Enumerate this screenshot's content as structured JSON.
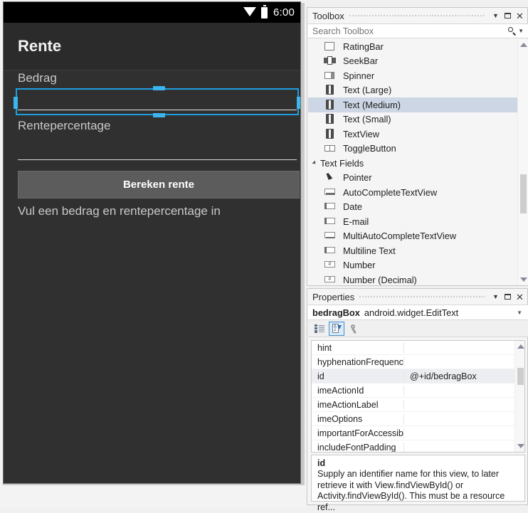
{
  "designer": {
    "status_bar": {
      "time": "6:00",
      "wifi_icon": "wifi-icon",
      "battery_icon": "battery-icon"
    },
    "app_title": "Rente",
    "labels": {
      "bedrag": "Bedrag",
      "rentepercentage": "Rentepercentage"
    },
    "bedrag_field_value": "",
    "rente_field_value": "",
    "button_label": "Bereken rente",
    "result_text": "Vul een bedrag en rentepercentage in",
    "selection_color": "#1e9fe0",
    "handle_color": "#3cb4ee"
  },
  "toolbox": {
    "title": "Toolbox",
    "window_buttons": {
      "dropdown": "chevron-down-icon",
      "maximize": "maximize-icon",
      "close": "close-icon"
    },
    "search": {
      "placeholder": "Search Toolbox",
      "value": "",
      "icon": "search-icon"
    },
    "items": [
      {
        "label": "RatingBar",
        "icon": "square-icon",
        "type": "item",
        "selected": false
      },
      {
        "label": "SeekBar",
        "icon": "seekbar-icon",
        "type": "item",
        "selected": false
      },
      {
        "label": "Spinner",
        "icon": "spinner-icon",
        "type": "item",
        "selected": false
      },
      {
        "label": "Text (Large)",
        "icon": "text-icon",
        "type": "item",
        "selected": false
      },
      {
        "label": "Text (Medium)",
        "icon": "text-icon",
        "type": "item",
        "selected": true
      },
      {
        "label": "Text (Small)",
        "icon": "text-icon",
        "type": "item",
        "selected": false
      },
      {
        "label": "TextView",
        "icon": "text-icon",
        "type": "item",
        "selected": false
      },
      {
        "label": "ToggleButton",
        "icon": "toggle-icon",
        "type": "item",
        "selected": false
      },
      {
        "label": "Text Fields",
        "icon": "expander-icon",
        "type": "group",
        "selected": false
      },
      {
        "label": "Pointer",
        "icon": "pointer-icon",
        "type": "item",
        "selected": false
      },
      {
        "label": "AutoCompleteTextView",
        "icon": "actv-icon",
        "type": "item",
        "selected": false
      },
      {
        "label": "Date",
        "icon": "textfield-icon",
        "type": "item",
        "selected": false
      },
      {
        "label": "E-mail",
        "icon": "textfield-icon",
        "type": "item",
        "selected": false
      },
      {
        "label": "MultiAutoCompleteTextView",
        "icon": "actv-icon",
        "type": "item",
        "selected": false
      },
      {
        "label": "Multiline Text",
        "icon": "textfield-icon",
        "type": "item",
        "selected": false
      },
      {
        "label": "Number",
        "icon": "number-icon",
        "type": "item",
        "selected": false
      },
      {
        "label": "Number (Decimal)",
        "icon": "number-icon",
        "type": "item",
        "selected": false
      }
    ]
  },
  "properties": {
    "title": "Properties",
    "window_buttons": {
      "dropdown": "chevron-down-icon",
      "maximize": "maximize-icon",
      "close": "close-icon"
    },
    "object": {
      "name": "bedragBox",
      "type": "android.widget.EditText"
    },
    "toolbar": {
      "categorized_label": "categorized-view-icon",
      "alphabetical_label": "alphabetical-sort-icon",
      "events_label": "wrench-icon"
    },
    "rows": [
      {
        "name": "hint",
        "value": "",
        "selected": false
      },
      {
        "name": "hyphenationFrequency",
        "value": "",
        "selected": false
      },
      {
        "name": "id",
        "value": "@+id/bedragBox",
        "selected": true
      },
      {
        "name": "imeActionId",
        "value": "",
        "selected": false
      },
      {
        "name": "imeActionLabel",
        "value": "",
        "selected": false
      },
      {
        "name": "imeOptions",
        "value": "",
        "selected": false
      },
      {
        "name": "importantForAccessibi",
        "value": "",
        "selected": false
      },
      {
        "name": "includeFontPadding",
        "value": "",
        "selected": false
      }
    ],
    "description": {
      "title": "id",
      "body": "Supply an identifier name for this view, to later retrieve it with View.findViewById() or Activity.findViewById(). This must be a resource ref..."
    }
  }
}
